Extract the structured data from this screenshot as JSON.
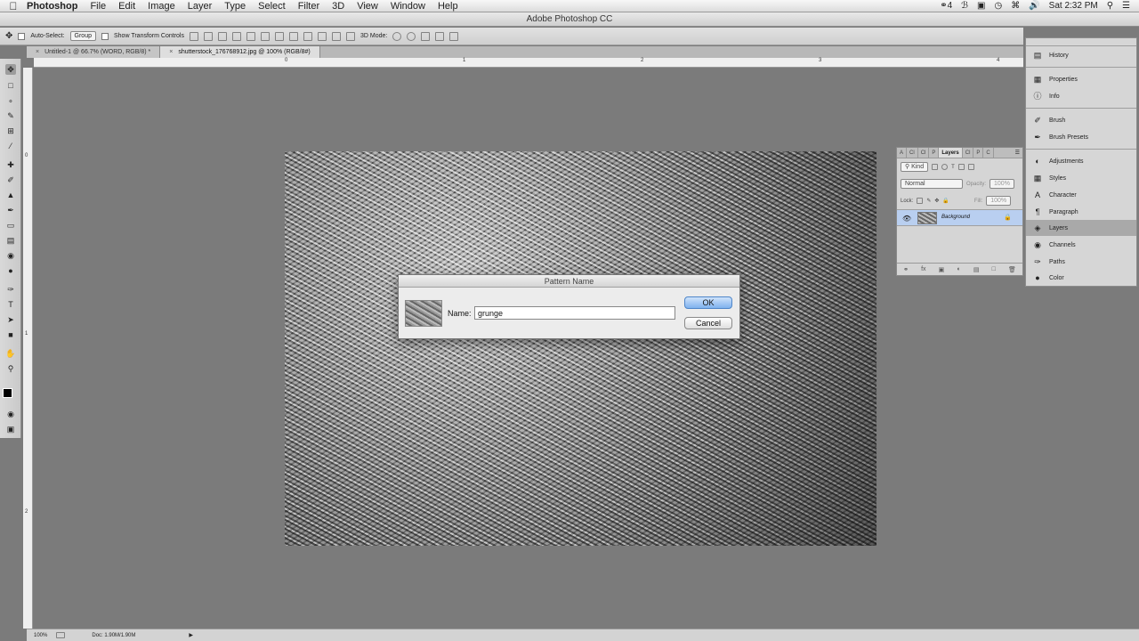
{
  "menubar": {
    "apple": "",
    "app": "Photoshop",
    "items": [
      "File",
      "Edit",
      "Image",
      "Layer",
      "Type",
      "Select",
      "Filter",
      "3D",
      "View",
      "Window",
      "Help"
    ],
    "status": {
      "badge": "4",
      "time": "Sat 2:32 PM"
    }
  },
  "window_title": "Adobe Photoshop CC",
  "options": {
    "auto_select": "Auto-Select:",
    "group": "Group",
    "show_transform": "Show Transform Controls",
    "mode_3d": "3D Mode:"
  },
  "tabs": [
    {
      "label": "Untitled-1 @ 66.7% (WORD, RGB/8) *"
    },
    {
      "label": "shutterstock_176768912.jpg @ 100% (RGB/8#)"
    }
  ],
  "ruler": {
    "h": [
      "0",
      "1",
      "2",
      "3",
      "4"
    ],
    "v": [
      "0",
      "1",
      "2"
    ]
  },
  "dialog": {
    "title": "Pattern Name",
    "name_label": "Name:",
    "name_value": "grunge",
    "ok": "OK",
    "cancel": "Cancel"
  },
  "layers_panel": {
    "tabs": [
      "A",
      "Cl",
      "Cl",
      "P",
      "Layers",
      "Cl",
      "P",
      "C"
    ],
    "filter": "Kind",
    "blend": "Normal",
    "opacity_label": "Opacity:",
    "opacity": "100%",
    "lock_label": "Lock:",
    "fill_label": "Fill:",
    "fill": "100%",
    "layer_name": "Background"
  },
  "dock": {
    "items": [
      "History",
      "Properties",
      "Info",
      "Brush",
      "Brush Presets",
      "Adjustments",
      "Styles",
      "Character",
      "Paragraph",
      "Layers",
      "Channels",
      "Paths",
      "Color"
    ]
  },
  "statusbar": {
    "zoom": "100%",
    "doc": "Doc: 1.90M/1.90M"
  },
  "colors": {
    "canvas_bg": "#7b7b7b",
    "ok_button": "#7fb2ee",
    "selected_layer": "#b9cff0"
  }
}
